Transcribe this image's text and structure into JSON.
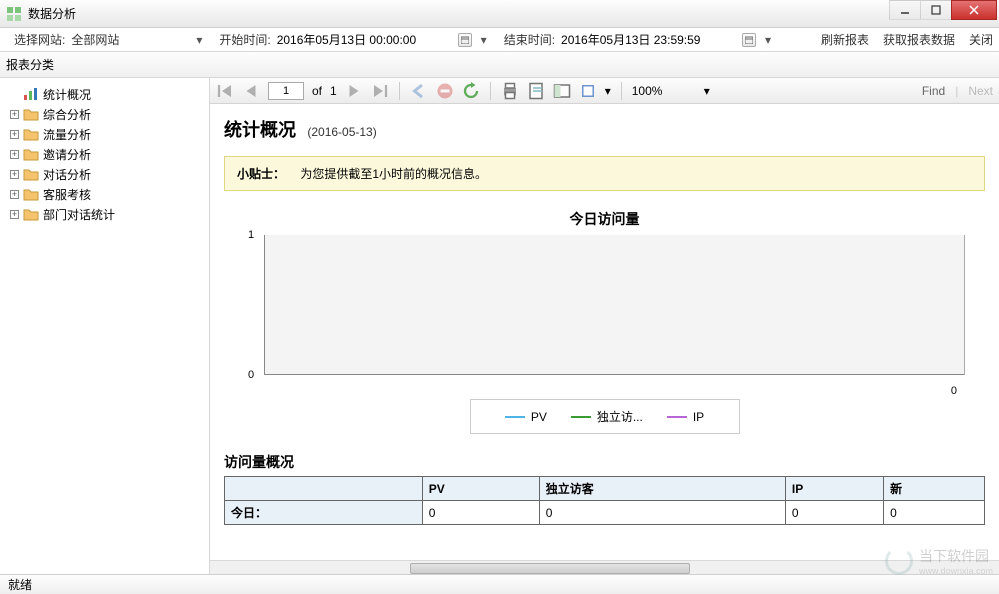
{
  "window": {
    "title": "数据分析"
  },
  "filter": {
    "site_label": "选择网站:",
    "site_value": "全部网站",
    "start_label": "开始时间:",
    "start_value": "2016年05月13日 00:00:00",
    "end_label": "结束时间:",
    "end_value": "2016年05月13日 23:59:59",
    "refresh": "刷新报表",
    "fetch": "获取报表数据",
    "close": "关闭"
  },
  "tree": {
    "header": "报表分类",
    "items": [
      {
        "label": "统计概况",
        "icon": "chart",
        "expander": "none"
      },
      {
        "label": "综合分析",
        "icon": "folder",
        "expander": "plus"
      },
      {
        "label": "流量分析",
        "icon": "folder",
        "expander": "plus"
      },
      {
        "label": "邀请分析",
        "icon": "folder",
        "expander": "plus"
      },
      {
        "label": "对话分析",
        "icon": "folder",
        "expander": "plus"
      },
      {
        "label": "客服考核",
        "icon": "folder",
        "expander": "plus"
      },
      {
        "label": "部门对话统计",
        "icon": "folder",
        "expander": "plus"
      }
    ]
  },
  "toolbar": {
    "page_current": "1",
    "page_of": "of",
    "page_total": "1",
    "zoom": "100%",
    "find": "Find",
    "next": "Next"
  },
  "report": {
    "title": "统计概况",
    "date": "(2016-05-13)",
    "tip_label": "小贴士：",
    "tip_text": "为您提供截至1小时前的概况信息。",
    "chart_title": "今日访问量",
    "table_title": "访问量概况",
    "columns": [
      "",
      "PV",
      "独立访客",
      "IP",
      "新"
    ],
    "rows": [
      {
        "label": "今日：",
        "values": [
          "0",
          "0",
          "0",
          "0"
        ]
      }
    ]
  },
  "legend": {
    "items": [
      {
        "name": "PV",
        "color": "#4fb4e6"
      },
      {
        "name": "独立访...",
        "color": "#3a9b35"
      },
      {
        "name": "IP",
        "color": "#b865d6"
      }
    ]
  },
  "status": {
    "text": "就绪"
  },
  "watermark": {
    "title": "当下软件园",
    "sub": "www.downxia.com"
  },
  "chart_data": {
    "type": "line",
    "title": "今日访问量",
    "xlabel": "",
    "ylabel": "",
    "ylim": [
      0,
      1
    ],
    "x": [
      0
    ],
    "xticklabels": [
      "0"
    ],
    "series": [
      {
        "name": "PV",
        "color": "#4fb4e6",
        "values": [
          0
        ]
      },
      {
        "name": "独立访客",
        "color": "#3a9b35",
        "values": [
          0
        ]
      },
      {
        "name": "IP",
        "color": "#b865d6",
        "values": [
          0
        ]
      }
    ]
  }
}
